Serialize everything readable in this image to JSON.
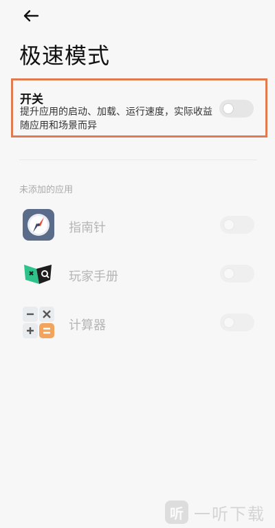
{
  "header": {
    "back_icon": "arrow-left-icon",
    "title": "极速模式"
  },
  "main_switch": {
    "title": "开关",
    "description": "提升应用的启动、加载、运行速度，实际收益随应用和场景而异",
    "enabled": false
  },
  "section": {
    "label": "未添加的应用"
  },
  "apps": [
    {
      "name": "指南针",
      "icon": "compass-icon",
      "enabled": false
    },
    {
      "name": "玩家手册",
      "icon": "player-manual-icon",
      "enabled": false
    },
    {
      "name": "计算器",
      "icon": "calculator-icon",
      "enabled": false
    }
  ],
  "watermark": {
    "logo_char": "听",
    "text": "一听下载"
  },
  "colors": {
    "highlight": "#e07a4f",
    "background": "#f7f7f7"
  }
}
